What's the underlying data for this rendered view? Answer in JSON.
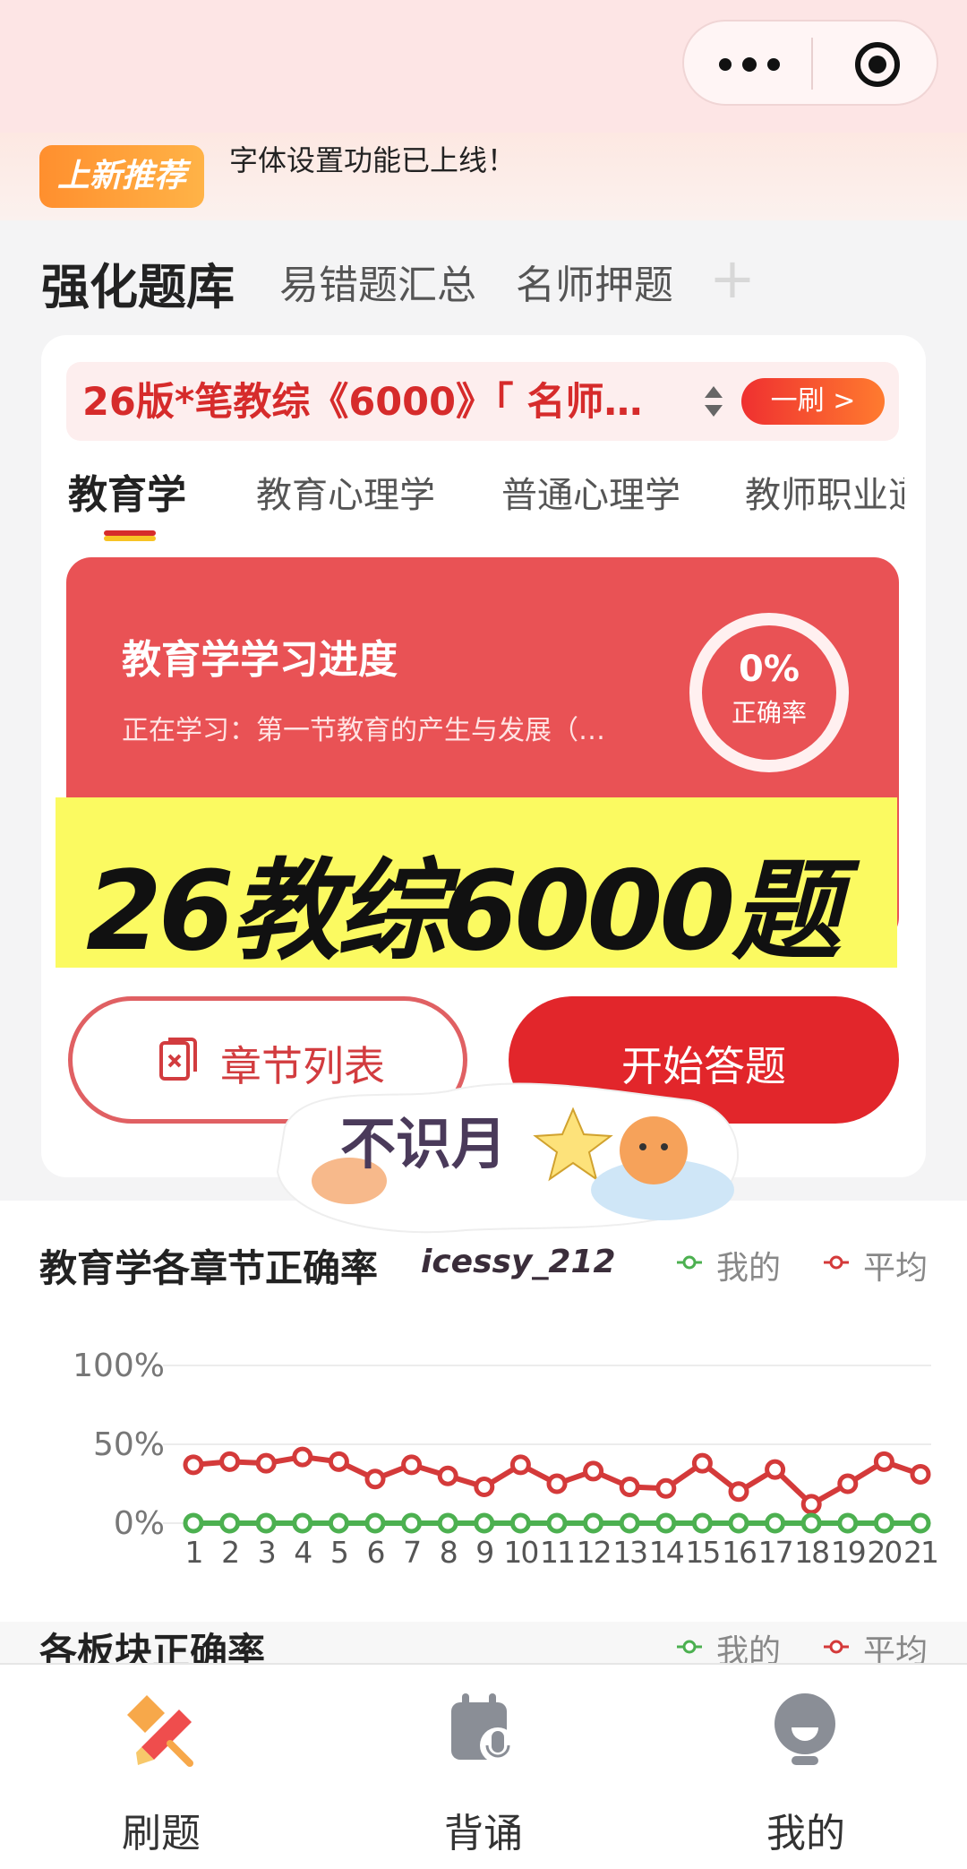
{
  "announcement": {
    "badge": "上新推荐",
    "text": "字体设置功能已上线！"
  },
  "tabs": [
    {
      "label": "强化题库",
      "active": true
    },
    {
      "label": "易错题汇总"
    },
    {
      "label": "名师押题"
    },
    {
      "label": "+"
    }
  ],
  "bank": {
    "name": "26版*笔教综《6000》「 名师…",
    "round_label": "一刷 >"
  },
  "subtabs": [
    {
      "label": "教育学",
      "active": true
    },
    {
      "label": "教育心理学"
    },
    {
      "label": "普通心理学"
    },
    {
      "label": "教师职业道"
    }
  ],
  "progress": {
    "title": "教育学学习进度",
    "current": "正在学习：第一节教育的产生与发展（…",
    "accuracy_value": "0%",
    "accuracy_label": "正确率"
  },
  "banner": {
    "text": "26教综6000题"
  },
  "actions": {
    "chapter_list": "章节列表",
    "start": "开始答题"
  },
  "sticker": {
    "text": "不识月"
  },
  "watermark": "icessy_212",
  "chart_section": {
    "title": "教育学各章节正确率",
    "legend_mine": "我的",
    "legend_avg": "平均"
  },
  "section2": {
    "title": "各板块正确率",
    "legend_mine": "我的",
    "legend_avg": "平均"
  },
  "colors": {
    "mine": "#4cb050",
    "avg": "#d43a3a",
    "accent": "#e2262b"
  },
  "chart_data": {
    "type": "line",
    "categories": [
      "1",
      "2",
      "3",
      "4",
      "5",
      "6",
      "7",
      "8",
      "9",
      "10",
      "11",
      "12",
      "13",
      "14",
      "15",
      "16",
      "17",
      "18",
      "19",
      "20",
      "21"
    ],
    "ylim": [
      0,
      100
    ],
    "yticks": [
      "100%",
      "50%",
      "0%"
    ],
    "grid": true,
    "legend_position": "top-right",
    "series": [
      {
        "name": "我的",
        "values": [
          0,
          0,
          0,
          0,
          0,
          0,
          0,
          0,
          0,
          0,
          0,
          0,
          0,
          0,
          0,
          0,
          0,
          0,
          0,
          0,
          0
        ]
      },
      {
        "name": "平均",
        "values": [
          37,
          39,
          38,
          42,
          39,
          28,
          37,
          30,
          23,
          37,
          25,
          33,
          23,
          22,
          38,
          20,
          34,
          12,
          25,
          39,
          31
        ]
      }
    ]
  },
  "nav": [
    {
      "label": "刷题",
      "icon": "pencil-icon",
      "active": true
    },
    {
      "label": "背诵",
      "icon": "calendar-mic-icon"
    },
    {
      "label": "我的",
      "icon": "profile-icon"
    }
  ]
}
